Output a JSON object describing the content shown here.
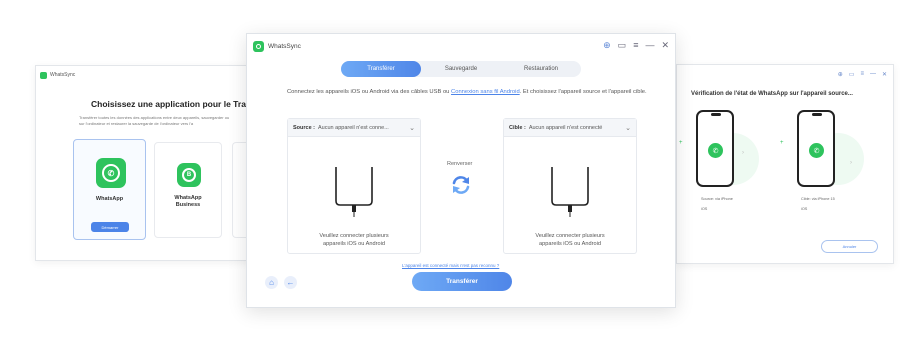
{
  "main": {
    "app_name": "WhatsSync",
    "tabs": [
      {
        "label": "Transférer"
      },
      {
        "label": "Sauvegarde"
      },
      {
        "label": "Restauration"
      }
    ],
    "intro_before": "Connectez les appareils iOS ou Android via des câbles USB ou ",
    "intro_link": "Connexion sans fil Android",
    "intro_after": ". Et choisissez l'appareil source et l'appareil cible.",
    "source": {
      "prefix": "Source :",
      "value": "Aucun appareil n'est conne...",
      "hint_l1": "Veuillez connecter plusieurs",
      "hint_l2": "appareils iOS ou Android"
    },
    "target": {
      "prefix": "Cible :",
      "value": "Aucun appareil n'est connecté",
      "hint_l1": "Veuillez connecter plusieurs",
      "hint_l2": "appareils iOS ou Android"
    },
    "swap_label": "Renverser",
    "help_link": "L'appareil est connecté mais n'est pas reconnu ?",
    "transfer_button": "Transférer",
    "icons": {
      "home": "home-icon",
      "back": "back-arrow-icon",
      "swap": "swap-arrows-icon"
    }
  },
  "left_window": {
    "app_name": "WhatsSync",
    "heading": "Choisissez une application pour le Transfert",
    "desc_l1": "Transférer toutes les données des applications entre deux appareils, sauvegarder ou",
    "desc_l2": "sur l'ordinateur et restaurer la sauvegarde de l'ordinateur vers l'a",
    "apps": [
      {
        "name": "WhatsApp",
        "button": "Démarrer"
      },
      {
        "name_l1": "WhatsApp",
        "name_l2": "Business"
      }
    ]
  },
  "right_window": {
    "heading": "Vérification de l'état de WhatsApp sur l'appareil source...",
    "phone1_label": "Source: via iPhone",
    "phone1_sub": "iOS",
    "phone2_label": "Cible: via iPhone 15",
    "phone2_sub": "iOS",
    "button": "Annuler"
  },
  "colors": {
    "accent": "#4f86e8",
    "whatsapp_green": "#2ec35d"
  }
}
